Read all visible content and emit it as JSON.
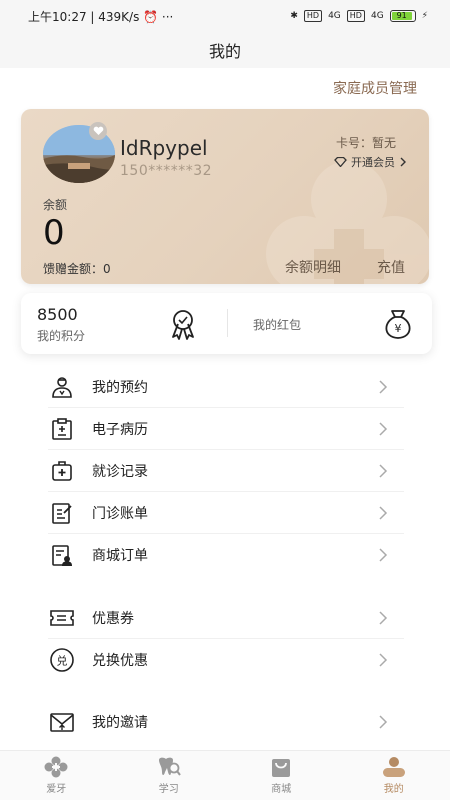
{
  "status_bar": {
    "time_speed": "上午10:27 | 439K/s",
    "extra": "⏰ ···",
    "network1": "HD",
    "net_label1": "4G",
    "network2": "HD",
    "net_label2": "4G",
    "battery": "91"
  },
  "header": {
    "title": "我的"
  },
  "family_link": "家庭成员管理",
  "member_card": {
    "nickname": "IdRpypel",
    "phone": "150******32",
    "card_no": "卡号：暂无",
    "vip_label": "开通会员",
    "balance_label": "余额",
    "balance_value": "0",
    "gift_amount": "馈赠金额：0",
    "balance_detail": "余额明细",
    "recharge": "充值"
  },
  "points": {
    "value": "8500",
    "label": "我的积分",
    "redpacket_label": "我的红包"
  },
  "menu_group1": [
    {
      "label": "我的预约",
      "icon": "doctor-icon"
    },
    {
      "label": "电子病历",
      "icon": "clipboard-icon"
    },
    {
      "label": "就诊记录",
      "icon": "medical-kit-icon"
    },
    {
      "label": "门诊账单",
      "icon": "bill-edit-icon"
    },
    {
      "label": "商城订单",
      "icon": "order-icon"
    }
  ],
  "menu_group2": [
    {
      "label": "优惠券",
      "icon": "coupon-icon"
    },
    {
      "label": "兑换优惠",
      "icon": "exchange-icon"
    }
  ],
  "menu_group3": [
    {
      "label": "我的邀请",
      "icon": "invite-envelope-icon"
    }
  ],
  "tabs": [
    {
      "label": "爱牙",
      "icon": "clover-icon",
      "active": false
    },
    {
      "label": "学习",
      "icon": "tooth-search-icon",
      "active": false
    },
    {
      "label": "商城",
      "icon": "shopping-bag-icon",
      "active": false
    },
    {
      "label": "我的",
      "icon": "profile-icon",
      "active": true
    }
  ],
  "colors": {
    "card_bg": "#e6d3be",
    "accent": "#b58b63",
    "text_brown": "#8a6a52"
  }
}
